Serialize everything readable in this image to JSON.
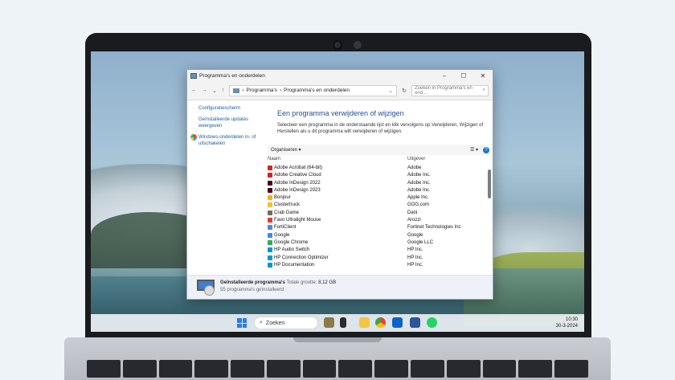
{
  "window": {
    "title": "Programma's en onderdelen",
    "controls": {
      "minimize": "–",
      "maximize": "☐",
      "close": "✕"
    }
  },
  "address": {
    "path_root": "Programma's",
    "path_sep": "›",
    "path_leaf": "Programma's en onderdelen",
    "search_placeholder": "Zoeken in Programma's en ond…"
  },
  "sidebar": {
    "items": [
      {
        "label": "Configuratiescherm"
      },
      {
        "label": "Geïnstalleerde updates weergeven"
      },
      {
        "label": "Windows-onderdelen in- of uitschakelen"
      }
    ]
  },
  "main": {
    "heading": "Een programma verwijderen of wijzigen",
    "description": "Selecteer een programma in de onderstaande lijst en klik vervolgens op Verwijderen, Wijzigen of Herstellen als u dit programma wilt verwijderen of wijzigen.",
    "organize_label": "Organiseren ▾",
    "view_icon": "☰ ▾",
    "help": "?"
  },
  "list": {
    "columns": {
      "name": "Naam",
      "publisher": "Uitgever"
    },
    "rows": [
      {
        "name": "Adobe Acrobat (64-bit)",
        "publisher": "Adobe",
        "color": "#d7261e"
      },
      {
        "name": "Adobe Creative Cloud",
        "publisher": "Adobe Inc.",
        "color": "#da1f26"
      },
      {
        "name": "Adobe InDesign 2022",
        "publisher": "Adobe Inc.",
        "color": "#49021f"
      },
      {
        "name": "Adobe InDesign 2023",
        "publisher": "Adobe Inc.",
        "color": "#49021f"
      },
      {
        "name": "Bonjour",
        "publisher": "Apple Inc.",
        "color": "#f2b21b"
      },
      {
        "name": "Clustertruck",
        "publisher": "GOG.com",
        "color": "#f0c22e"
      },
      {
        "name": "Crab Game",
        "publisher": "Dani",
        "color": "#6c6c6c"
      },
      {
        "name": "Favo Ultralight Mouse",
        "publisher": "Arozzi",
        "color": "#e23a2e"
      },
      {
        "name": "FortiClient",
        "publisher": "Fortinet Technologies Inc",
        "color": "#4f8ad2"
      },
      {
        "name": "Google",
        "publisher": "Google",
        "color": "#4285f4"
      },
      {
        "name": "Google Chrome",
        "publisher": "Google LLC",
        "color": "#34a853"
      },
      {
        "name": "HP Audio Switch",
        "publisher": "HP Inc.",
        "color": "#0096d6"
      },
      {
        "name": "HP Connection Optimizer",
        "publisher": "HP Inc.",
        "color": "#0096d6"
      },
      {
        "name": "HP Documentation",
        "publisher": "HP Inc.",
        "color": "#0096d6"
      }
    ]
  },
  "details": {
    "title": "Geïnstalleerde programma's",
    "size_label": "Totale grootte:",
    "size_value": "8,12 GB",
    "count": "55 programma's geïnstalleerd"
  },
  "taskbar": {
    "search_label": "Zoeken",
    "time": "10:30",
    "date": "30-3-2024"
  }
}
